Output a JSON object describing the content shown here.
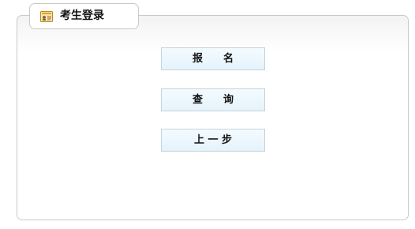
{
  "panel": {
    "title": "考生登录",
    "icon": "id-card-icon"
  },
  "buttons": [
    {
      "label": "报　　名"
    },
    {
      "label": "查　　询"
    },
    {
      "label": "上 一 步"
    }
  ],
  "colors": {
    "panel_border": "#c9c9c9",
    "button_border": "#c5d2db",
    "button_fill": "#e4f3fb",
    "icon_accent": "#e0a020"
  }
}
